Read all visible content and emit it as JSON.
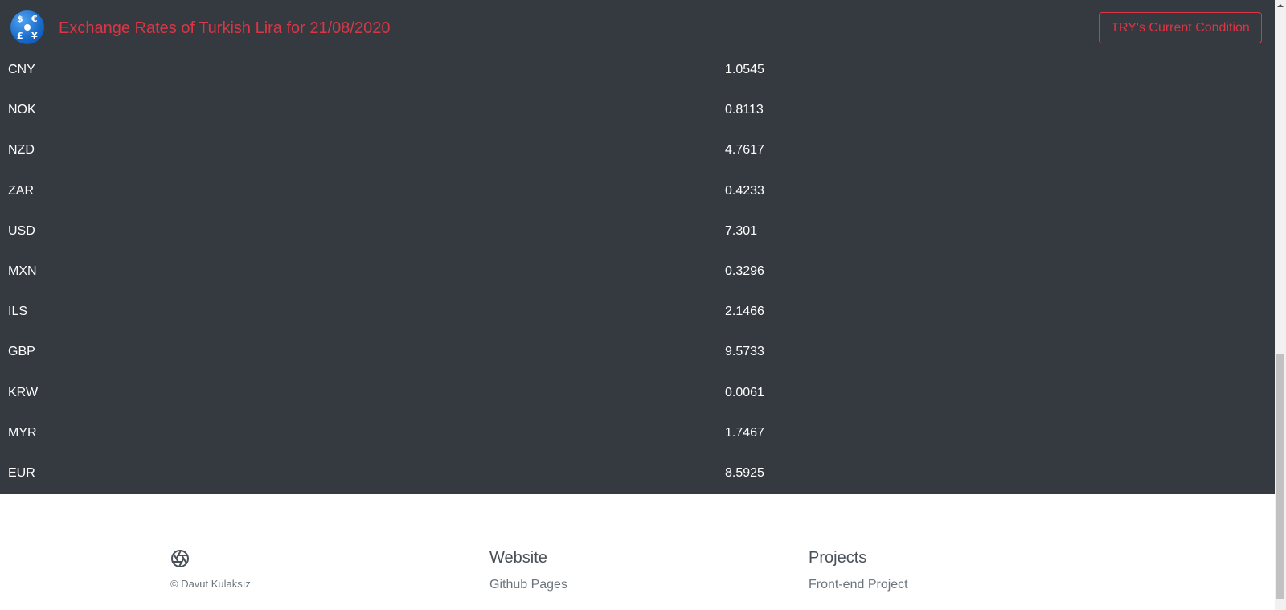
{
  "header": {
    "title": "Exchange Rates of Turkish Lira for 21/08/2020",
    "button_label": "TRY's Current Condition",
    "logo_icon": "currency-coin-icon",
    "logo_symbols": [
      "$",
      "€",
      "£",
      "¥"
    ]
  },
  "rates": [
    {
      "code": "CNY",
      "value": "1.0545"
    },
    {
      "code": "NOK",
      "value": "0.8113"
    },
    {
      "code": "NZD",
      "value": "4.7617"
    },
    {
      "code": "ZAR",
      "value": "0.4233"
    },
    {
      "code": "USD",
      "value": "7.301"
    },
    {
      "code": "MXN",
      "value": "0.3296"
    },
    {
      "code": "ILS",
      "value": "2.1466"
    },
    {
      "code": "GBP",
      "value": "9.5733"
    },
    {
      "code": "KRW",
      "value": "0.0061"
    },
    {
      "code": "MYR",
      "value": "1.7467"
    },
    {
      "code": "EUR",
      "value": "8.5925"
    }
  ],
  "footer": {
    "icon": "aperture-icon",
    "copyright": "© Davut Kulaksız",
    "website_heading": "Website",
    "website_link": "Github Pages",
    "projects_heading": "Projects",
    "projects_link": "Front-end Project"
  },
  "colors": {
    "dark_background": "#343a40",
    "accent": "#dc3545",
    "text_light": "#ffffff",
    "footer_text": "#6c757d"
  }
}
